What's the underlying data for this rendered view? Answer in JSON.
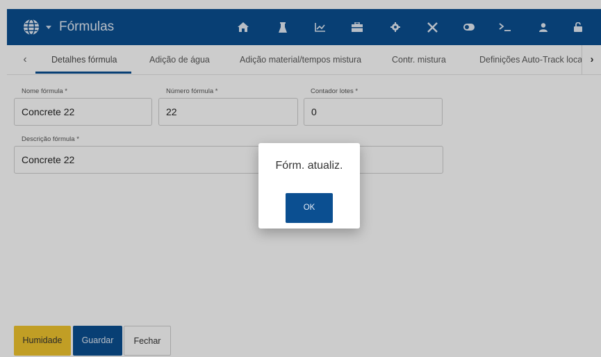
{
  "header": {
    "title": "Fórmulas",
    "icons": [
      "globe-icon",
      "chevron-down-icon",
      "home-icon",
      "flask-icon",
      "chart-icon",
      "toolbox-icon",
      "gear-icon",
      "tools-icon",
      "toggle-icon",
      "terminal-icon",
      "user-icon",
      "unlock-icon"
    ]
  },
  "tabs": {
    "items": [
      {
        "label": "Detalhes fórmula"
      },
      {
        "label": "Adição de água"
      },
      {
        "label": "Adição material/tempos mistura"
      },
      {
        "label": "Contr. mistura"
      },
      {
        "label": "Definições Auto-Track local"
      }
    ],
    "prev_icon": "‹",
    "next_icon": "›"
  },
  "form": {
    "nome": {
      "label": "Nome fórmula *",
      "value": "Concrete 22"
    },
    "numero": {
      "label": "Número fórmula *",
      "value": "22"
    },
    "contador": {
      "label": "Contador lotes *",
      "value": "0"
    },
    "descricao": {
      "label": "Descrição fórmula *",
      "value": "Concrete 22"
    }
  },
  "footer": {
    "humidade": "Humidade",
    "guardar": "Guardar",
    "fechar": "Fechar"
  },
  "dialog": {
    "message": "Fórm. atualiz.",
    "ok": "OK"
  },
  "colors": {
    "primary": "#0b4f91",
    "accent_yellow": "#f2c62f"
  }
}
